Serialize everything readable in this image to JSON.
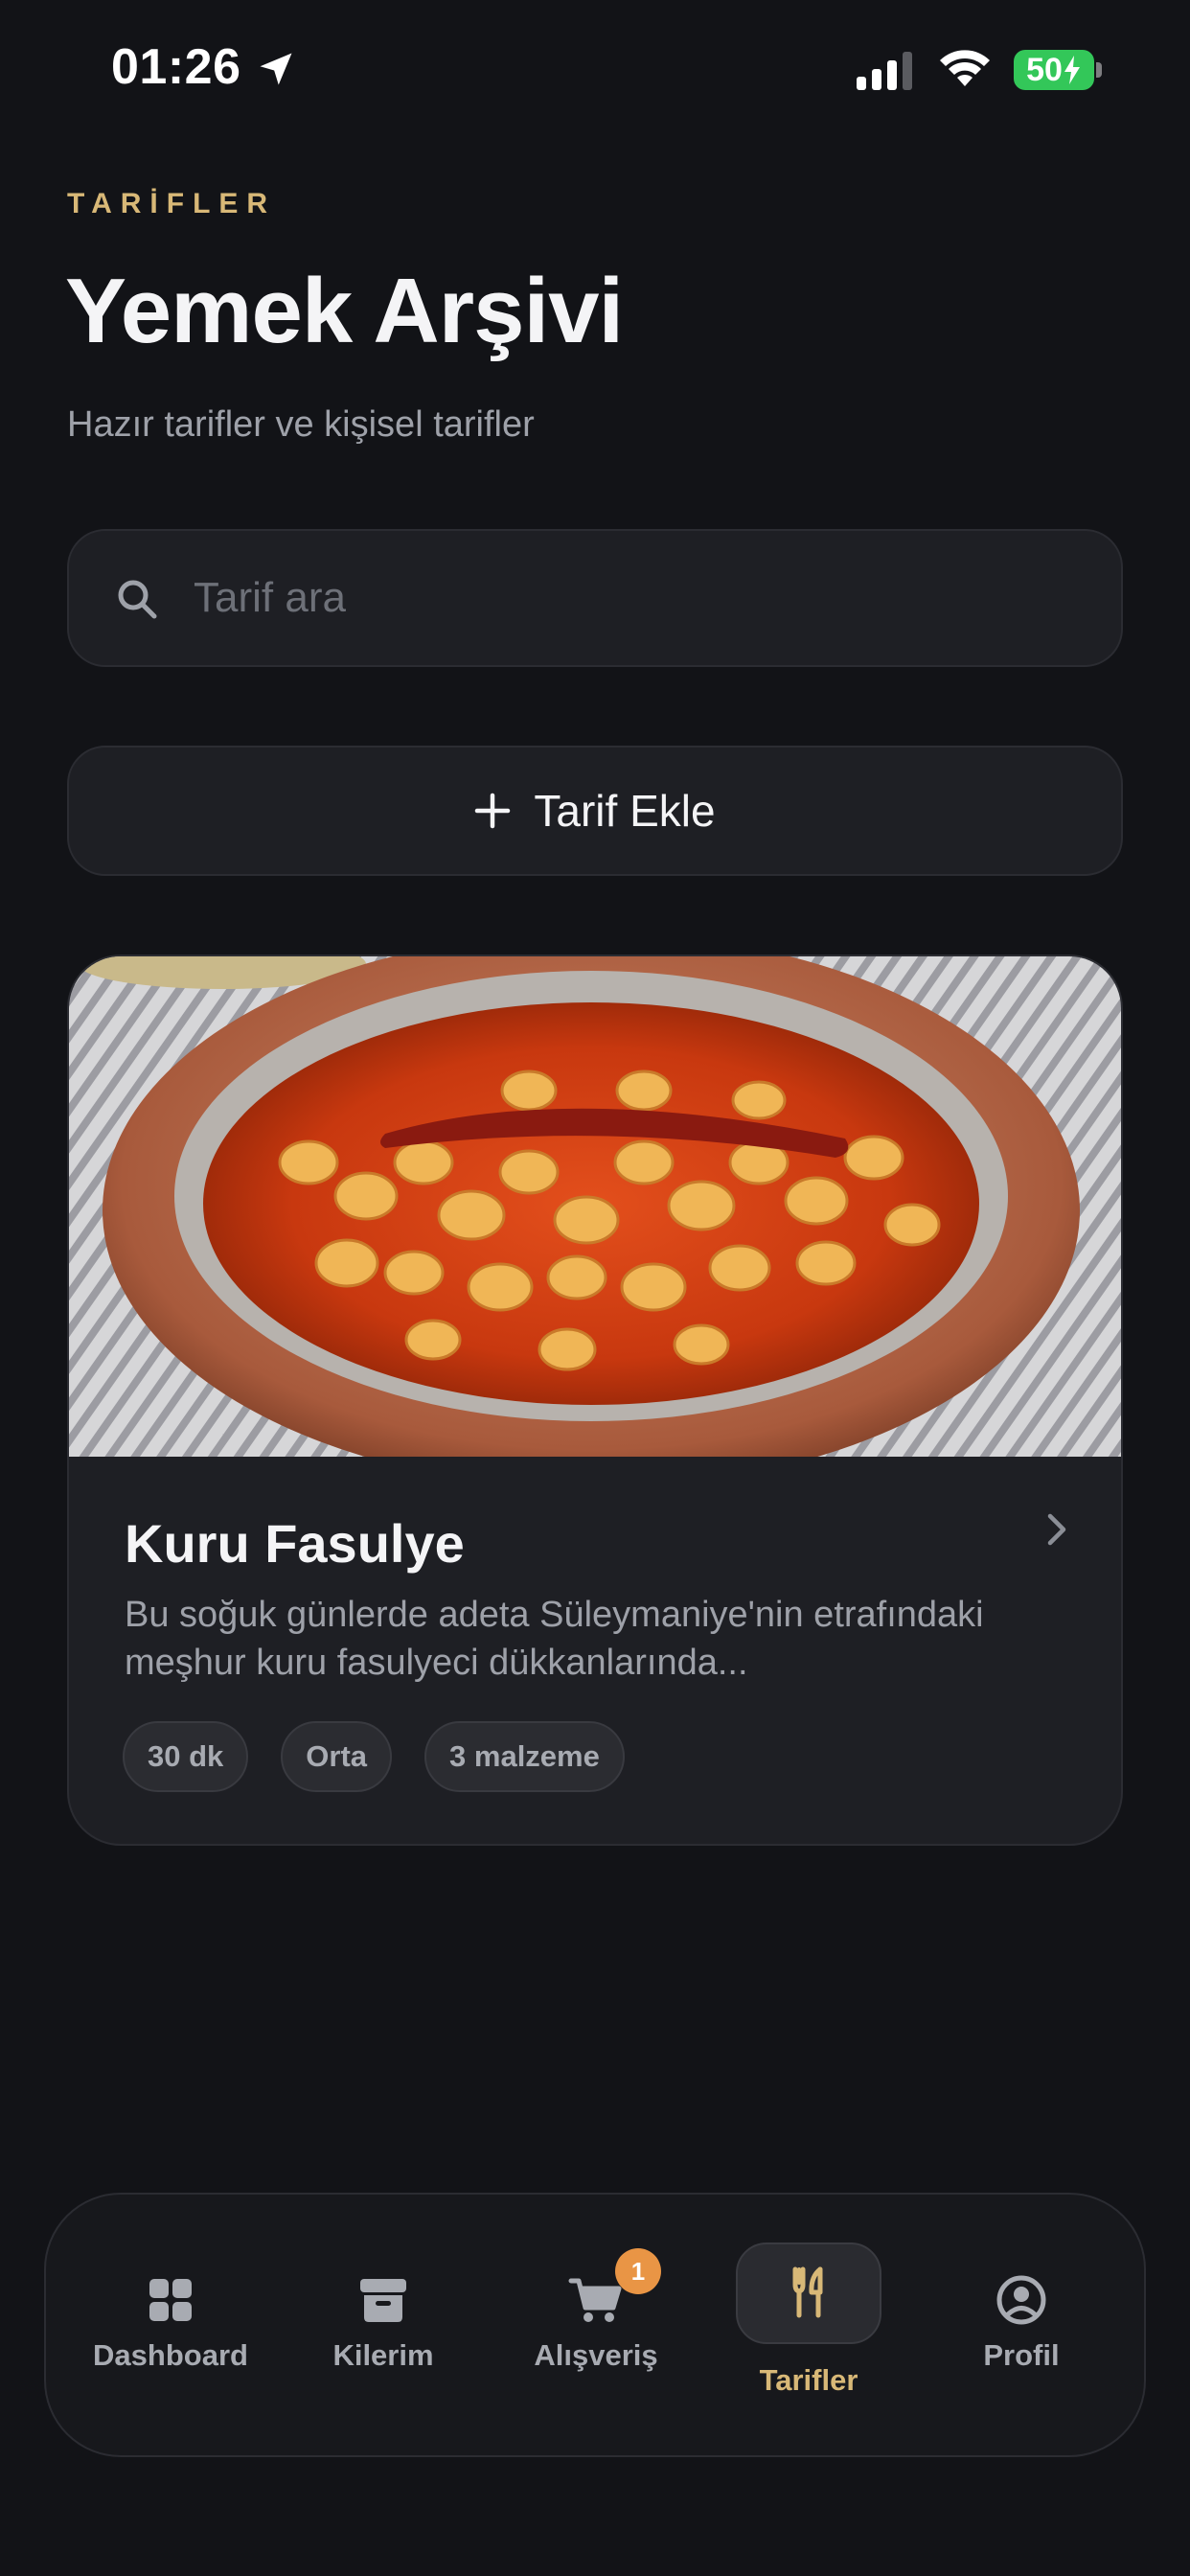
{
  "status_bar": {
    "time": "01:26",
    "battery": "50",
    "icons": [
      "location-arrow-icon",
      "signal-icon",
      "wifi-icon",
      "battery-charging-icon"
    ]
  },
  "header": {
    "eyebrow": "TARİFLER",
    "title": "Yemek Arşivi",
    "subtitle": "Hazır tarifler ve kişisel tarifler"
  },
  "search": {
    "placeholder": "Tarif ara",
    "value": ""
  },
  "add_button": {
    "label": "Tarif Ekle"
  },
  "recipes": [
    {
      "title": "Kuru Fasulye",
      "description": "Bu soğuk günlerde adeta Süleymaniye'nin etrafındaki meşhur kuru fasulyeci dükkanlarında...",
      "tags": [
        "30 dk",
        "Orta",
        "3 malzeme"
      ],
      "image": "kuru-fasulye-photo"
    }
  ],
  "tabbar": {
    "items": [
      {
        "label": "Dashboard",
        "icon": "grid-icon",
        "active": false
      },
      {
        "label": "Kilerim",
        "icon": "archive-box-icon",
        "active": false
      },
      {
        "label": "Alışveriş",
        "icon": "cart-icon",
        "active": false,
        "badge": "1"
      },
      {
        "label": "Tarifler",
        "icon": "fork-knife-icon",
        "active": true
      },
      {
        "label": "Profil",
        "icon": "user-circle-icon",
        "active": false
      }
    ]
  },
  "colors": {
    "background": "#121317",
    "surface": "#1e1f24",
    "accent_gold": "#d8b877",
    "badge_orange": "#e99545",
    "battery_green": "#33c759"
  }
}
